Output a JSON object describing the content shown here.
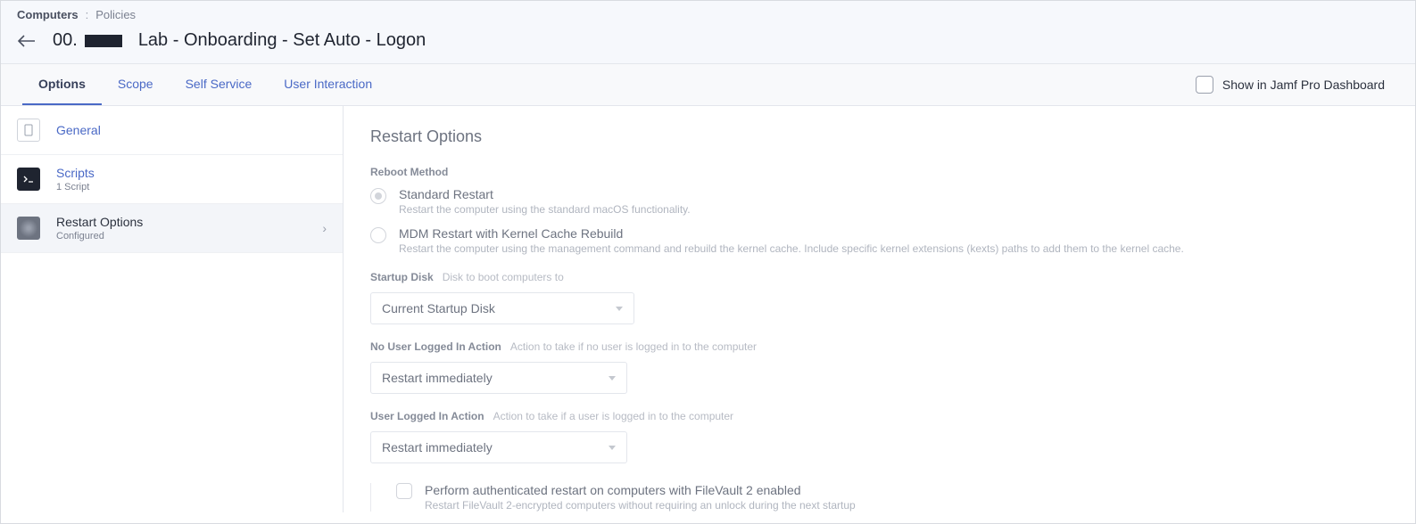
{
  "breadcrumb": {
    "root": "Computers",
    "sep": ":",
    "leaf": "Policies"
  },
  "header": {
    "prefix_num": "00.",
    "title": "Lab - Onboarding - Set Auto - Logon"
  },
  "tabs": {
    "options": "Options",
    "scope": "Scope",
    "self_service": "Self Service",
    "user_interaction": "User Interaction",
    "dashboard_toggle": "Show in Jamf Pro Dashboard"
  },
  "sidebar": {
    "general": {
      "label": "General"
    },
    "scripts": {
      "label": "Scripts",
      "sub": "1 Script"
    },
    "restart": {
      "label": "Restart Options",
      "sub": "Configured"
    }
  },
  "panel": {
    "title": "Restart Options",
    "reboot_label": "Reboot Method",
    "std_title": "Standard Restart",
    "std_desc": "Restart the computer using the standard macOS functionality.",
    "mdm_title": "MDM Restart with Kernel Cache Rebuild",
    "mdm_desc": "Restart the computer using the management command and rebuild the kernel cache. Include specific kernel extensions (kexts) paths to add them to the kernel cache.",
    "startup_label": "Startup Disk",
    "startup_hint": "Disk to boot computers to",
    "startup_value": "Current Startup Disk",
    "nouser_label": "No User Logged In Action",
    "nouser_hint": "Action to take if no user is logged in to the computer",
    "nouser_value": "Restart immediately",
    "user_label": "User Logged In Action",
    "user_hint": "Action to take if a user is logged in to the computer",
    "user_value": "Restart immediately",
    "fv_title": "Perform authenticated restart on computers with FileVault 2 enabled",
    "fv_desc": "Restart FileVault 2-encrypted computers without requiring an unlock during the next startup"
  }
}
